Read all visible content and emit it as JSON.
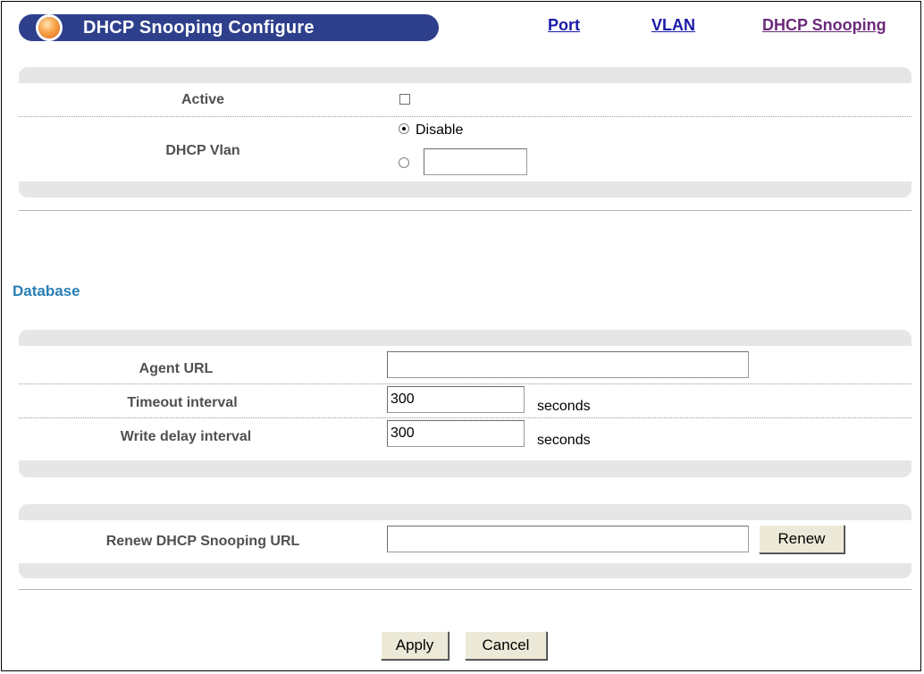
{
  "header": {
    "title": "DHCP Snooping Configure",
    "nav": {
      "port": "Port",
      "vlan": "VLAN",
      "dhcp_snooping": "DHCP Snooping"
    }
  },
  "general": {
    "active_label": "Active",
    "active_checked": false,
    "dhcp_vlan_label": "DHCP Vlan",
    "disable_option_label": "Disable",
    "selected_option": "Disable",
    "vlan_value": ""
  },
  "database": {
    "section_title": "Database",
    "agent_url_label": "Agent URL",
    "agent_url_value": "",
    "timeout_label": "Timeout interval",
    "timeout_value": "300",
    "timeout_unit": "seconds",
    "write_delay_label": "Write delay interval",
    "write_delay_value": "300",
    "write_delay_unit": "seconds"
  },
  "renew": {
    "label": "Renew DHCP Snooping URL",
    "url_value": "",
    "button_label": "Renew"
  },
  "actions": {
    "apply_label": "Apply",
    "cancel_label": "Cancel"
  },
  "colors": {
    "title_bar": "#2e3f8c",
    "section_title": "#2a7fb5",
    "link": "#1a1aa8",
    "visited_link": "#6b2a7a",
    "panel": "#e6e6e6"
  }
}
